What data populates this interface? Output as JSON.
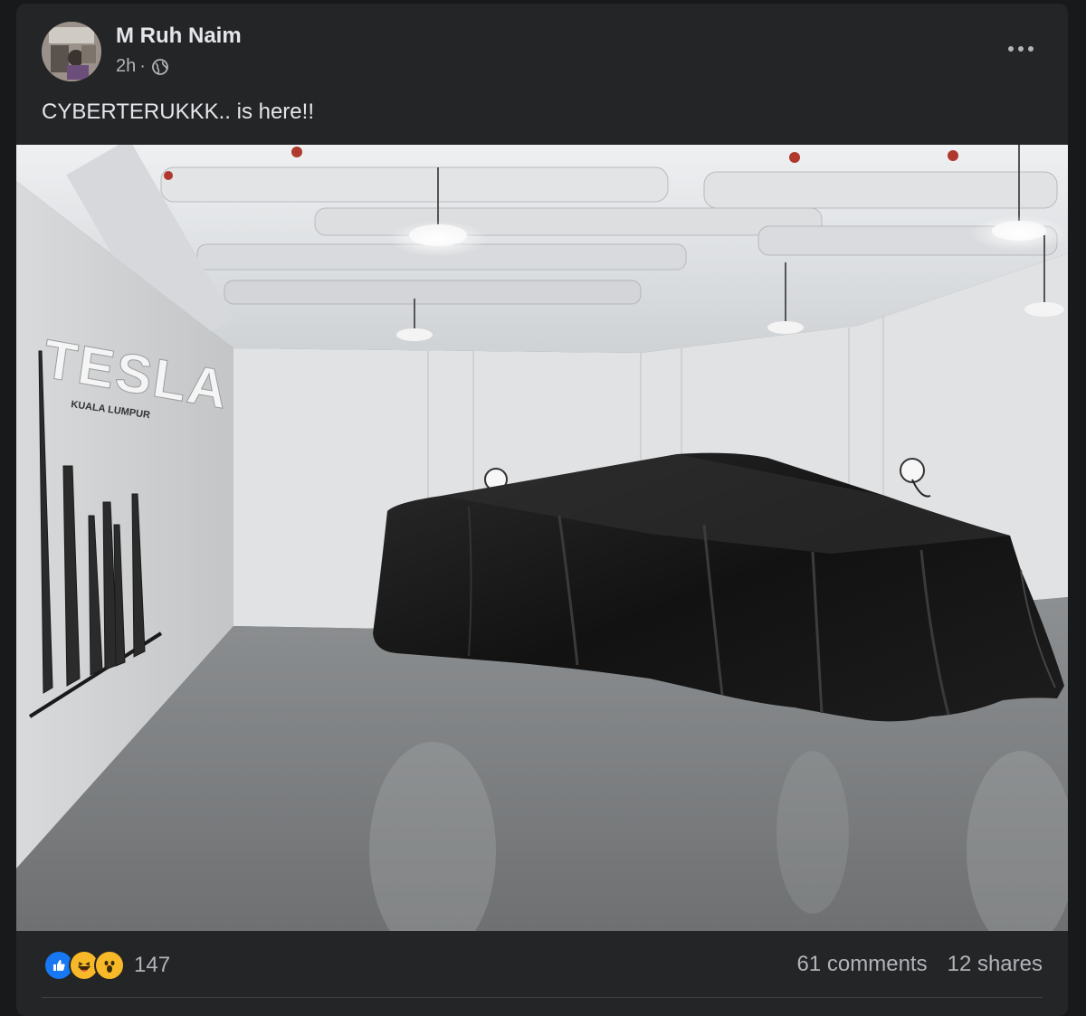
{
  "post": {
    "author": "M Ruh Naim",
    "time": "2h",
    "separator": "·",
    "caption": "CYBERTERUKKK.. is here!!",
    "image": {
      "sign_text": "TESLA",
      "sign_subtext": "KUALA LUMPUR"
    },
    "reactions": {
      "icons": [
        "like-icon",
        "haha-icon",
        "wow-icon"
      ],
      "count": "147"
    },
    "comments": "61 comments",
    "shares": "12 shares"
  },
  "colors": {
    "background": "#18191a",
    "card": "#242526",
    "text_primary": "#e4e6eb",
    "text_secondary": "#b0b3b8",
    "like_blue": "#1877f2",
    "emoji_yellow": "#f7b928"
  }
}
